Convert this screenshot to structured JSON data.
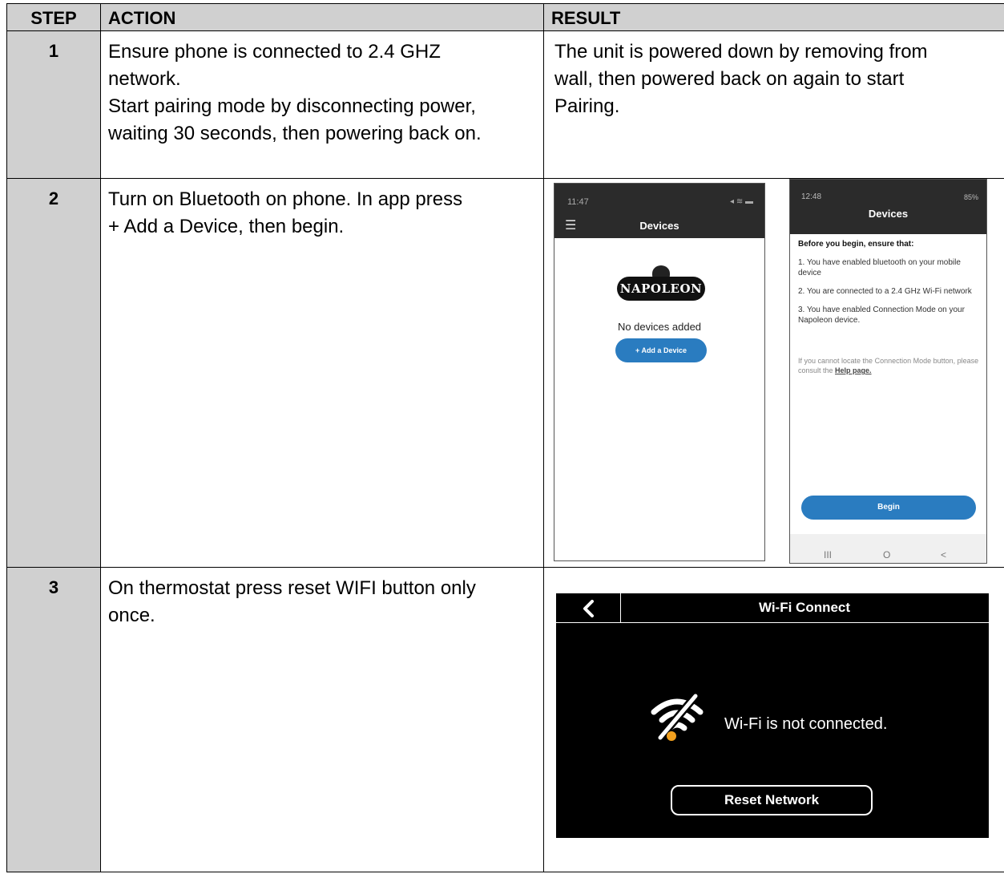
{
  "table": {
    "headers": {
      "step": "STEP",
      "action": "ACTION",
      "result": "RESULT"
    },
    "rows": [
      {
        "step": "1",
        "action": [
          "Ensure phone is connected to 2.4 GHZ",
          "network.",
          "Start pairing mode by disconnecting power,",
          "waiting 30 seconds, then powering back on."
        ],
        "result": [
          "The unit is powered down by removing from",
          "wall, then powered back on again to start",
          "Pairing."
        ]
      },
      {
        "step": "2",
        "action": [
          "Turn on Bluetooth on phone. In app press",
          "+ Add a Device, then begin."
        ]
      },
      {
        "step": "3",
        "action": [
          "On thermostat press reset WIFI button only",
          "once."
        ]
      }
    ]
  },
  "phone_devices": {
    "time": "11:47",
    "title": "Devices",
    "logo_text": "NAPOLEON",
    "empty_text": "No devices added",
    "add_button": "+ Add a Device"
  },
  "phone_begin": {
    "time": "12:48",
    "status": "85%",
    "title": "Devices",
    "lead": "Before you begin, ensure that:",
    "items": [
      "1. You have enabled bluetooth on your mobile device",
      "2. You are connected to a 2.4 GHz Wi-Fi network",
      "3. You have enabled Connection Mode on your Napoleon device."
    ],
    "help_text": "If you cannot locate the Connection Mode button, please consult the",
    "help_link": "Help page.",
    "begin_button": "Begin",
    "nav": [
      "III",
      "O",
      "<"
    ]
  },
  "thermostat": {
    "title": "Wi-Fi Connect",
    "message": "Wi-Fi is not connected.",
    "reset_button": "Reset Network",
    "icon": "wifi-off-icon",
    "accent": "#f2a01e"
  }
}
